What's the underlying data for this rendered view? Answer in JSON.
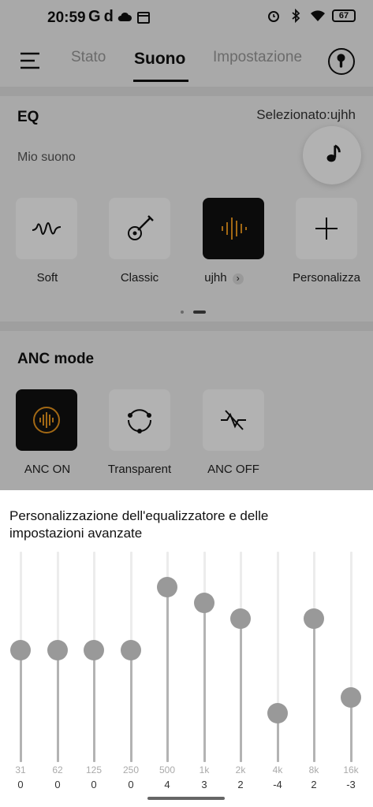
{
  "status_bar": {
    "time": "20:59",
    "left_icons": [
      "google-icon",
      "d-app-icon",
      "cloud-icon",
      "calendar-icon"
    ],
    "right_icons": [
      "alarm-icon",
      "bluetooth-icon",
      "wifi-icon"
    ],
    "battery": "67"
  },
  "tabs": [
    {
      "label": "Stato",
      "active": false
    },
    {
      "label": "Suono",
      "active": true
    },
    {
      "label": "Impostazione",
      "active": false
    }
  ],
  "eq": {
    "title": "EQ",
    "selected_label": "Selezionato:ujhh",
    "subtitle": "Mio suono",
    "presets": [
      {
        "label": "Soft",
        "icon": "wave-icon",
        "selected": false
      },
      {
        "label": "Classic",
        "icon": "guitar-icon",
        "selected": false
      },
      {
        "label": "ujhh",
        "icon": "soundbars-icon",
        "selected": true,
        "chevron": "›"
      },
      {
        "label": "Personalizza",
        "icon": "plus-icon",
        "selected": false
      }
    ],
    "page_indicator": {
      "pages": 2,
      "current": 2
    }
  },
  "anc": {
    "title": "ANC mode",
    "modes": [
      {
        "label": "ANC ON",
        "icon": "anc-on-icon",
        "selected": true
      },
      {
        "label": "Transparent",
        "icon": "transparent-icon",
        "selected": false
      },
      {
        "label": "ANC OFF",
        "icon": "anc-off-icon",
        "selected": false
      }
    ]
  },
  "equalizer_sheet": {
    "title": "Personalizzazione dell'equalizzatore e delle impostazioni avanzate",
    "gain_range": [
      -6,
      6
    ],
    "bands": [
      {
        "freq": "31",
        "gain": 0
      },
      {
        "freq": "62",
        "gain": 0
      },
      {
        "freq": "125",
        "gain": 0
      },
      {
        "freq": "250",
        "gain": 0
      },
      {
        "freq": "500",
        "gain": 4
      },
      {
        "freq": "1k",
        "gain": 3
      },
      {
        "freq": "2k",
        "gain": 2
      },
      {
        "freq": "4k",
        "gain": -4
      },
      {
        "freq": "8k",
        "gain": 2
      },
      {
        "freq": "16k",
        "gain": -3
      }
    ]
  },
  "colors": {
    "accent": "#e8961e",
    "selected_bg": "#111111",
    "knob": "#999999"
  }
}
